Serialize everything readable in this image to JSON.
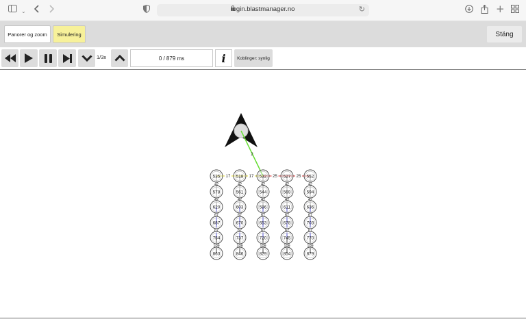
{
  "browser": {
    "url": "login.blastmanager.no",
    "icons": [
      "sidebar-icon",
      "chevron-down-icon",
      "back-icon",
      "forward-icon",
      "shield-icon",
      "lock-icon",
      "reload-icon",
      "download-icon",
      "share-icon",
      "new-tab-icon",
      "tab-overview-icon"
    ]
  },
  "toolbar": {
    "pan_zoom_label": "Panorer og zoom",
    "simulation_label": "Simulering",
    "close_label": "Stäng"
  },
  "playback": {
    "speed_label": "1/3x",
    "time_display": "0 / 879 ms",
    "info_label": "i",
    "connections_label": "Koblinger: synlig"
  },
  "diagram": {
    "rows": [
      [
        "535",
        "518",
        "532",
        "527",
        "552"
      ],
      [
        "578",
        "561",
        "544",
        "569",
        "594"
      ],
      [
        "620",
        "603",
        "586",
        "611",
        "636"
      ],
      [
        "687",
        "670",
        "653",
        "678",
        "703"
      ],
      [
        "754",
        "737",
        "720",
        "745",
        "770"
      ],
      [
        "863",
        "846",
        "829",
        "854",
        "879"
      ]
    ],
    "horizontal_delays": [
      "17",
      "17",
      "25",
      "25"
    ],
    "vertical_delays": [
      "42",
      "42",
      "67",
      "67",
      "109"
    ],
    "initiation_delay": "2",
    "colors": {
      "initiation_line": "#66dd33",
      "horizontal_left": "#e8e04a",
      "horizontal_right": "#e05555",
      "vertical_top": "#999999",
      "vertical_mid": "#3333cc",
      "vertical_bottom": "#222222"
    }
  }
}
